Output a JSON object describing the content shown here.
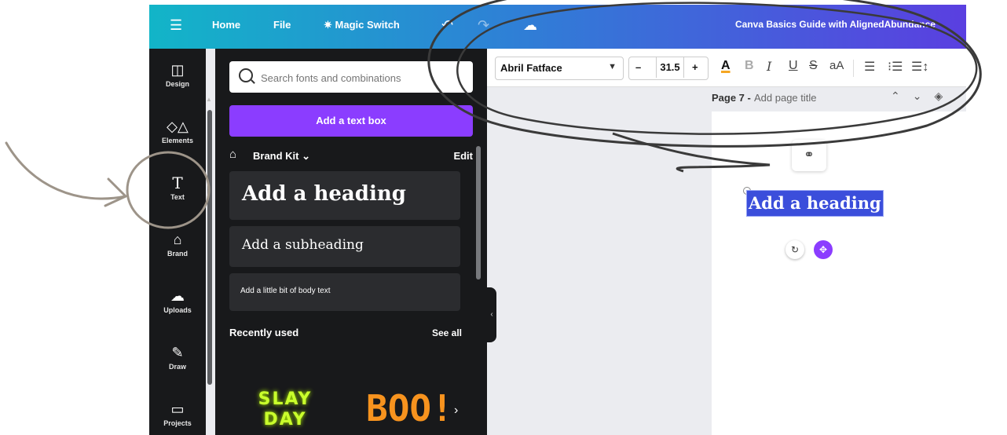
{
  "topbar": {
    "home": "Home",
    "file": "File",
    "magic_switch": "Magic Switch",
    "doc_title": "Canva Basics Guide with AlignedAbundance"
  },
  "rail": [
    {
      "label": "Design",
      "icon": "design-icon"
    },
    {
      "label": "Elements",
      "icon": "elements-icon"
    },
    {
      "label": "Text",
      "icon": "text-icon"
    },
    {
      "label": "Brand",
      "icon": "brand-icon"
    },
    {
      "label": "Uploads",
      "icon": "uploads-icon"
    },
    {
      "label": "Draw",
      "icon": "draw-icon"
    },
    {
      "label": "Projects",
      "icon": "projects-icon"
    }
  ],
  "panel": {
    "search_placeholder": "Search fonts and combinations",
    "add_text_box": "Add a text box",
    "brand_kit": "Brand Kit",
    "edit": "Edit",
    "heading": "Add a heading",
    "subheading": "Add a subheading",
    "body": "Add a little bit of body text",
    "recently_used": "Recently used",
    "see_all": "See all",
    "recent_1": "SLAY DAY",
    "recent_2": "BOO!"
  },
  "toolbar": {
    "font": "Abril Fatface",
    "size_minus": "–",
    "size": "31.5",
    "size_plus": "+",
    "color_label": "A",
    "bold": "B",
    "italic": "I",
    "underline": "U",
    "strike": "S",
    "case": "aA"
  },
  "page": {
    "label": "Page 7 -",
    "add_title": "Add page title",
    "selected_text": "Add a heading"
  },
  "colors": {
    "accent": "#8b3dff",
    "selection": "#3b4edb",
    "annotation": "#9d9489"
  }
}
